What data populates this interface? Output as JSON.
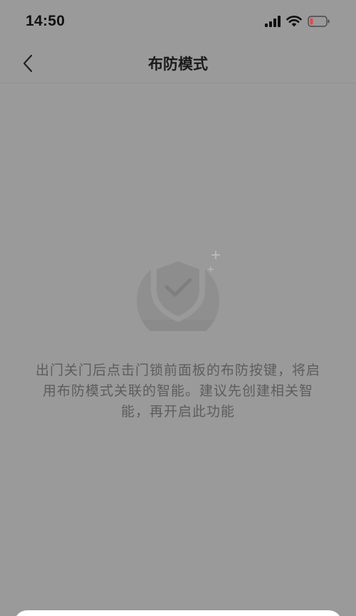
{
  "status_bar": {
    "time": "14:50"
  },
  "nav": {
    "title": "布防模式",
    "back_icon": "chevron-left-icon"
  },
  "empty_state": {
    "icon": "shield-check-icon",
    "message": "出门关门后点击门锁前面板的布防按键，将启用布防模式关联的智能。建议先创建相关智能，再开启此功能"
  },
  "colors": {
    "overlay_background": "#999a99",
    "title_text": "#1a1a1a",
    "body_text": "#5c5d5c",
    "battery_low": "#e5484d"
  }
}
